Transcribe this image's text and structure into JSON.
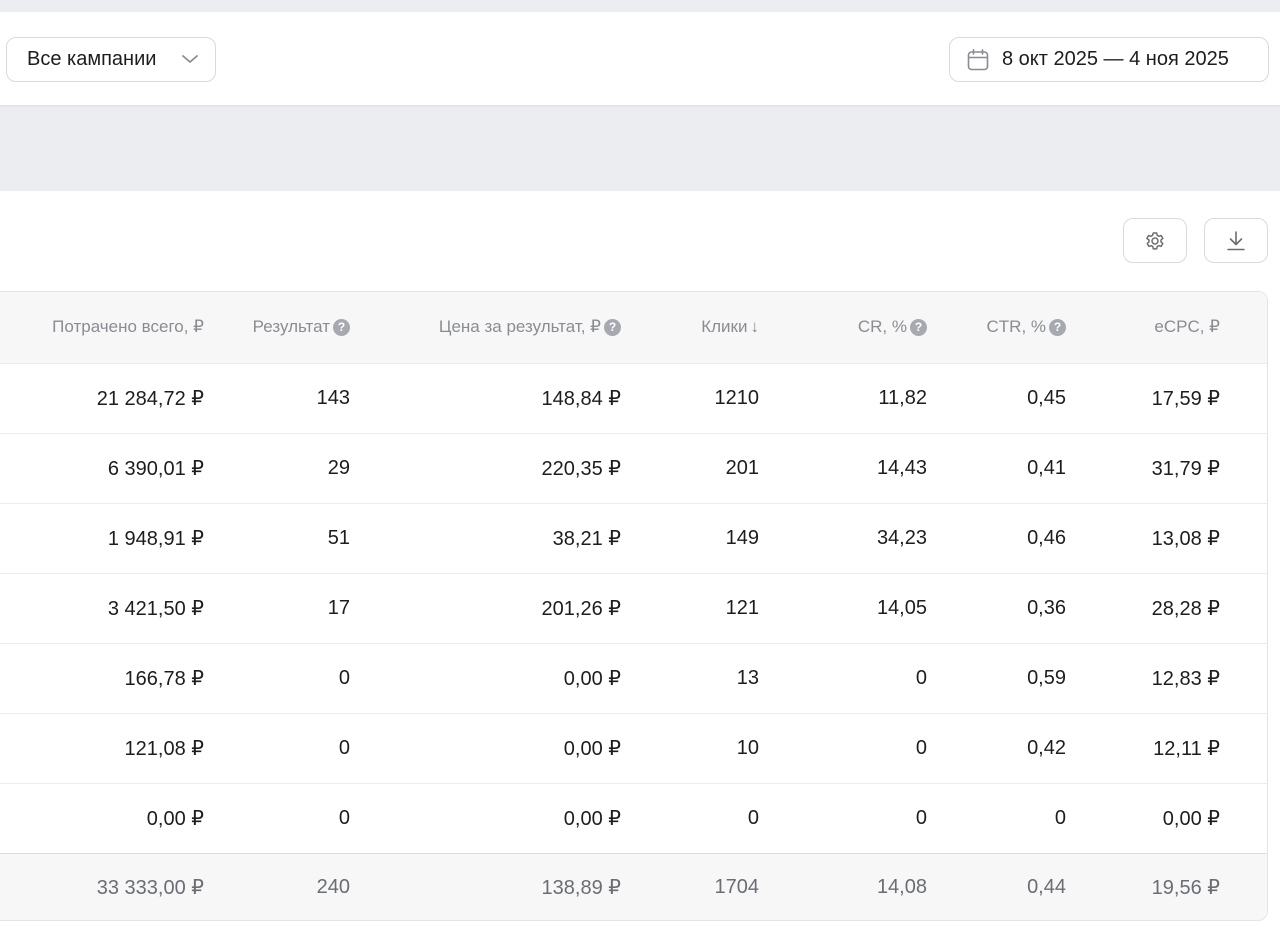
{
  "filters": {
    "campaign_select": "Все кампании",
    "date_range": "8 окт 2025 — 4 ноя 2025"
  },
  "toolbar": {
    "settings_icon": "gear-icon",
    "download_icon": "download-icon"
  },
  "table": {
    "headers": [
      "Потрачено всего, ₽",
      "Результат",
      "Цена за результат, ₽",
      "Клики",
      "CR, %",
      "CTR, %",
      "eCPC, ₽"
    ],
    "header_help": [
      false,
      true,
      true,
      false,
      true,
      true,
      false
    ],
    "sort_column": "Клики",
    "sort_direction": "desc",
    "rows": [
      [
        "21 284,72 ₽",
        "143",
        "148,84 ₽",
        "1210",
        "11,82",
        "0,45",
        "17,59 ₽"
      ],
      [
        "6 390,01 ₽",
        "29",
        "220,35 ₽",
        "201",
        "14,43",
        "0,41",
        "31,79 ₽"
      ],
      [
        "1 948,91 ₽",
        "51",
        "38,21 ₽",
        "149",
        "34,23",
        "0,46",
        "13,08 ₽"
      ],
      [
        "3 421,50 ₽",
        "17",
        "201,26 ₽",
        "121",
        "14,05",
        "0,36",
        "28,28 ₽"
      ],
      [
        "166,78 ₽",
        "0",
        "0,00 ₽",
        "13",
        "0",
        "0,59",
        "12,83 ₽"
      ],
      [
        "121,08 ₽",
        "0",
        "0,00 ₽",
        "10",
        "0",
        "0,42",
        "12,11 ₽"
      ],
      [
        "0,00 ₽",
        "0",
        "0,00 ₽",
        "0",
        "0",
        "0",
        "0,00 ₽"
      ]
    ],
    "totals": [
      "33 333,00 ₽",
      "240",
      "138,89 ₽",
      "1704",
      "14,08",
      "0,44",
      "19,56 ₽"
    ]
  }
}
